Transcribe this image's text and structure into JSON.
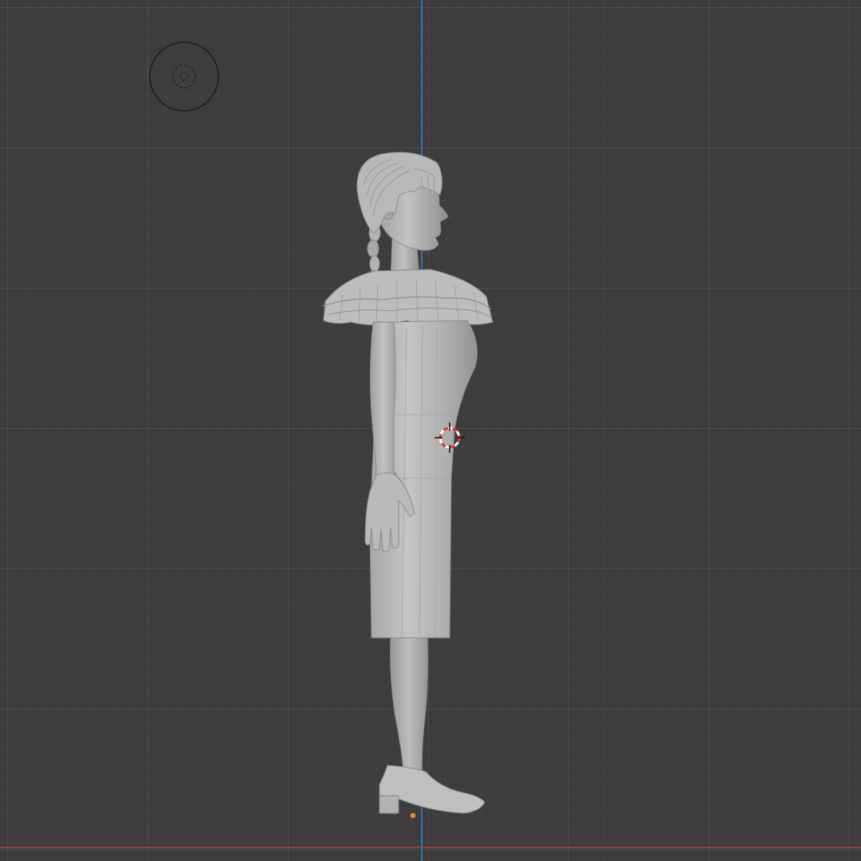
{
  "viewport": {
    "view": "right-orthographic",
    "background_color": "#3d3d3d",
    "minor_grid_color": "#474747",
    "major_grid_color": "#555555",
    "z_axis_color": "#3a6fb0",
    "y_axis_color": "#9a3a40"
  },
  "scene": {
    "model": "female-figure-in-dress",
    "model_color": "#b6b6b6",
    "model_shadow_color": "#8e8e8e",
    "objects": [
      "camera-object",
      "3d-cursor",
      "origin-point",
      "character-mesh"
    ],
    "origin_color": "#e8891c",
    "cursor_colors": [
      "#e03030",
      "#ffffff"
    ]
  }
}
